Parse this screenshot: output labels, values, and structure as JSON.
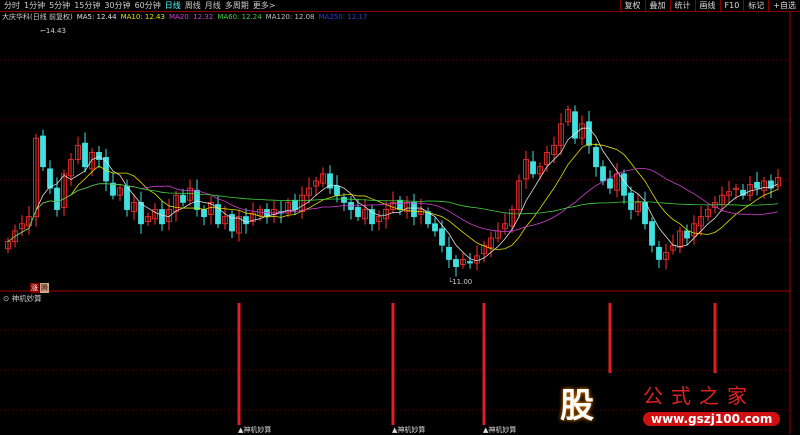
{
  "toolbar": {
    "periods": [
      "分时",
      "1分钟",
      "5分钟",
      "15分钟",
      "30分钟",
      "60分钟",
      "日线",
      "周线",
      "月线",
      "多周期",
      "更多>"
    ],
    "active": "日线",
    "right_buttons": [
      "复权",
      "叠加",
      "统计",
      "画线",
      "F10",
      "标记",
      "+自选"
    ]
  },
  "legend": {
    "title": "大庆华科(日线 前复权)",
    "ma": [
      {
        "label": "MA5: 12.44",
        "color": "#e0e0e0"
      },
      {
        "label": "MA10: 12.43",
        "color": "#e0e000"
      },
      {
        "label": "MA20: 12.32",
        "color": "#d040d0"
      },
      {
        "label": "MA60: 12.24",
        "color": "#40d040"
      },
      {
        "label": "MA120: 12.08",
        "color": "#c0c0c0"
      },
      {
        "label": "MA250: 12.17",
        "color": "#3040d0"
      }
    ]
  },
  "annotations": {
    "high": "14.43",
    "low": "11.00",
    "markers": [
      "涨",
      "腾"
    ]
  },
  "indicator": {
    "title": "神机妙算",
    "signal_label": "▲神机妙算",
    "signal_indices": [
      33,
      55,
      68,
      86,
      101
    ],
    "labeled_count": 3,
    "color": "#e02020"
  },
  "logo": {
    "char": "股",
    "text": "公式之家",
    "url": "www.gszj100.com"
  },
  "chart_data": {
    "type": "candlestick",
    "ylim": [
      10.9,
      14.6
    ],
    "up_color": "#ff3030",
    "down_color": "#40e0e0",
    "close": [
      11.55,
      11.7,
      11.8,
      11.9,
      13.0,
      12.6,
      12.3,
      12.0,
      12.5,
      12.7,
      12.9,
      12.6,
      12.8,
      12.7,
      12.4,
      12.2,
      12.3,
      12.0,
      12.1,
      11.8,
      11.9,
      12.0,
      11.8,
      12.0,
      12.2,
      12.1,
      12.3,
      12.0,
      11.9,
      12.1,
      11.8,
      11.9,
      11.7,
      11.9,
      11.8,
      11.95,
      12.0,
      11.9,
      12.0,
      11.95,
      12.1,
      12.0,
      12.2,
      12.3,
      12.4,
      12.5,
      12.3,
      12.2,
      12.1,
      12.0,
      11.9,
      12.0,
      11.8,
      11.9,
      12.0,
      12.1,
      12.0,
      12.1,
      11.9,
      12.0,
      11.8,
      11.7,
      11.5,
      11.3,
      11.2,
      11.3,
      11.25,
      11.35,
      11.5,
      11.6,
      11.7,
      11.8,
      12.0,
      12.4,
      12.7,
      12.5,
      12.6,
      12.8,
      12.9,
      13.2,
      13.4,
      13.0,
      13.2,
      12.9,
      12.6,
      12.4,
      12.3,
      12.5,
      12.2,
      12.0,
      12.1,
      11.8,
      11.5,
      11.3,
      11.4,
      11.5,
      11.7,
      11.6,
      11.8,
      11.9,
      12.0,
      12.1,
      12.2,
      12.25,
      12.3,
      12.2,
      12.35,
      12.3,
      12.4,
      12.3,
      12.45
    ]
  }
}
